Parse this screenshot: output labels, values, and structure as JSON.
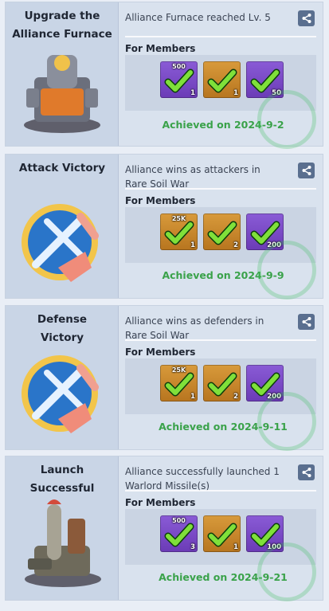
{
  "colors": {
    "achieved_green": "#3aa24a",
    "purple_tile": "#7b4bc6",
    "orange_tile": "#c98b31",
    "share_button_bg": "#5a6f8f"
  },
  "common": {
    "for_members_label": "For Members",
    "share_icon": "share-icon",
    "check_icon": "checkmark-icon"
  },
  "cards": [
    {
      "title_lines": [
        "Upgrade the",
        "Alliance Furnace"
      ],
      "description": "Alliance Furnace reached Lv. 5",
      "rewards": [
        {
          "badge": "500",
          "qty": "1",
          "color": "purple"
        },
        {
          "badge": "",
          "qty": "1",
          "color": "orange"
        },
        {
          "badge": "",
          "qty": "50",
          "color": "purple"
        }
      ],
      "achieved_text": "Achieved on 2024-9-2",
      "art": "alliance-furnace-illustration"
    },
    {
      "title_lines": [
        "Attack Victory"
      ],
      "description": "Alliance wins as attackers in Rare Soil War",
      "rewards": [
        {
          "badge": "25K",
          "qty": "1",
          "color": "orange"
        },
        {
          "badge": "",
          "qty": "2",
          "color": "orange"
        },
        {
          "badge": "",
          "qty": "200",
          "color": "purple"
        }
      ],
      "achieved_text": "Achieved on 2024-9-9",
      "art": "attack-victory-emblem"
    },
    {
      "title_lines": [
        "Defense",
        "Victory"
      ],
      "description": "Alliance wins as defenders in Rare Soil War",
      "rewards": [
        {
          "badge": "25K",
          "qty": "1",
          "color": "orange"
        },
        {
          "badge": "",
          "qty": "2",
          "color": "orange"
        },
        {
          "badge": "",
          "qty": "200",
          "color": "purple"
        }
      ],
      "achieved_text": "Achieved on 2024-9-11",
      "art": "defense-victory-emblem"
    },
    {
      "title_lines": [
        "Launch",
        "Successful"
      ],
      "description": "Alliance successfully launched 1 Warlord Missile(s)",
      "rewards": [
        {
          "badge": "500",
          "qty": "3",
          "color": "purple"
        },
        {
          "badge": "",
          "qty": "1",
          "color": "orange"
        },
        {
          "badge": "",
          "qty": "100",
          "color": "purple"
        }
      ],
      "achieved_text": "Achieved on 2024-9-21",
      "art": "warlord-missile-illustration"
    }
  ]
}
